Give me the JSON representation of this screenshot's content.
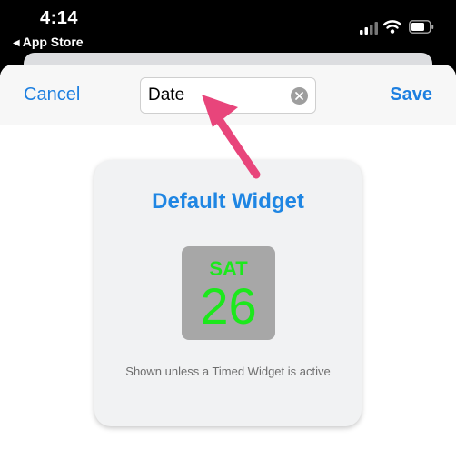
{
  "status_bar": {
    "time": "4:14",
    "back_app": "App Store",
    "back_icon": "back-triangle-icon",
    "signal_icon": "cellular-signal-icon",
    "wifi_icon": "wifi-icon",
    "battery_icon": "battery-icon"
  },
  "navbar": {
    "cancel_label": "Cancel",
    "save_label": "Save",
    "name_value": "Date",
    "clear_icon": "clear-x-icon"
  },
  "widget": {
    "title": "Default Widget",
    "day": "SAT",
    "date": "26",
    "caption": "Shown unless a Timed Widget is active"
  },
  "colors": {
    "accent": "#1d7fe0",
    "date_text": "#1ce81c",
    "tile": "#a7a7a7",
    "arrow": "#e8457b"
  }
}
